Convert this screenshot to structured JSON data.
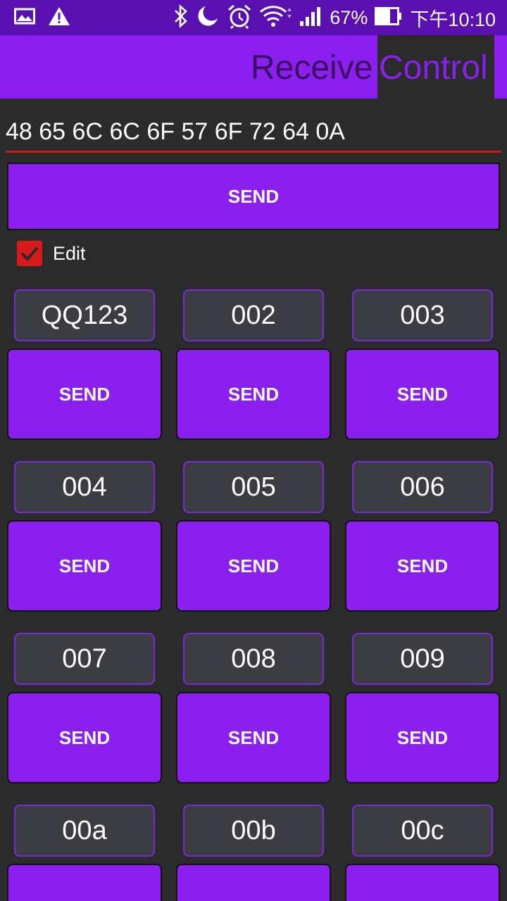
{
  "status_bar": {
    "battery": "67%",
    "time": "下午10:10",
    "icons": [
      "gallery-icon",
      "warning-icon",
      "bluetooth-icon",
      "moon-icon",
      "alarm-icon",
      "wifi-icon",
      "signal-icon",
      "battery-icon"
    ]
  },
  "tabs": [
    {
      "label": "Receive",
      "active": false
    },
    {
      "label": "Control",
      "active": true
    }
  ],
  "hex_input": {
    "value": "48 65 6C 6C 6F 57 6F 72 64 0A"
  },
  "main_send": {
    "label": "SEND"
  },
  "edit": {
    "label": "Edit",
    "checked": true
  },
  "slots": [
    {
      "value": "QQ123",
      "button": "SEND"
    },
    {
      "value": "002",
      "button": "SEND"
    },
    {
      "value": "003",
      "button": "SEND"
    },
    {
      "value": "004",
      "button": "SEND"
    },
    {
      "value": "005",
      "button": "SEND"
    },
    {
      "value": "006",
      "button": "SEND"
    },
    {
      "value": "007",
      "button": "SEND"
    },
    {
      "value": "008",
      "button": "SEND"
    },
    {
      "value": "009",
      "button": "SEND"
    },
    {
      "value": "00a",
      "button": ""
    },
    {
      "value": "00b",
      "button": ""
    },
    {
      "value": "00c",
      "button": ""
    }
  ],
  "colors": {
    "accent": "#8a1ff0",
    "status_bar": "#5a0fb0",
    "underline": "#d21919",
    "checkbox": "#d91a1a",
    "background": "#2b2b2b"
  }
}
